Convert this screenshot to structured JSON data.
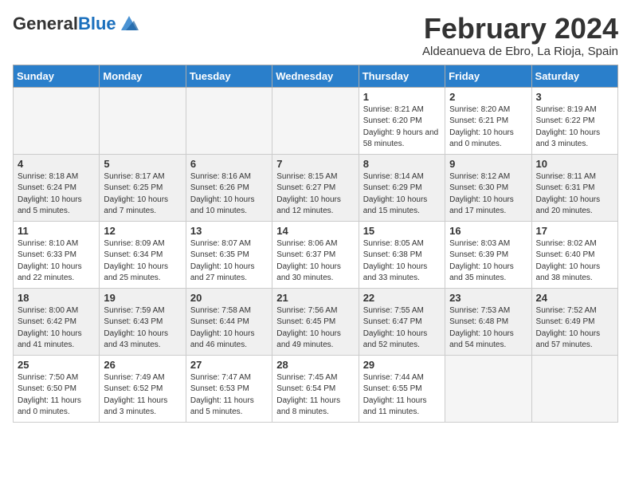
{
  "header": {
    "logo_general": "General",
    "logo_blue": "Blue",
    "month_title": "February 2024",
    "location": "Aldeanueva de Ebro, La Rioja, Spain"
  },
  "days_of_week": [
    "Sunday",
    "Monday",
    "Tuesday",
    "Wednesday",
    "Thursday",
    "Friday",
    "Saturday"
  ],
  "weeks": [
    [
      {
        "day": "",
        "info": ""
      },
      {
        "day": "",
        "info": ""
      },
      {
        "day": "",
        "info": ""
      },
      {
        "day": "",
        "info": ""
      },
      {
        "day": "1",
        "info": "Sunrise: 8:21 AM\nSunset: 6:20 PM\nDaylight: 9 hours and 58 minutes."
      },
      {
        "day": "2",
        "info": "Sunrise: 8:20 AM\nSunset: 6:21 PM\nDaylight: 10 hours and 0 minutes."
      },
      {
        "day": "3",
        "info": "Sunrise: 8:19 AM\nSunset: 6:22 PM\nDaylight: 10 hours and 3 minutes."
      }
    ],
    [
      {
        "day": "4",
        "info": "Sunrise: 8:18 AM\nSunset: 6:24 PM\nDaylight: 10 hours and 5 minutes."
      },
      {
        "day": "5",
        "info": "Sunrise: 8:17 AM\nSunset: 6:25 PM\nDaylight: 10 hours and 7 minutes."
      },
      {
        "day": "6",
        "info": "Sunrise: 8:16 AM\nSunset: 6:26 PM\nDaylight: 10 hours and 10 minutes."
      },
      {
        "day": "7",
        "info": "Sunrise: 8:15 AM\nSunset: 6:27 PM\nDaylight: 10 hours and 12 minutes."
      },
      {
        "day": "8",
        "info": "Sunrise: 8:14 AM\nSunset: 6:29 PM\nDaylight: 10 hours and 15 minutes."
      },
      {
        "day": "9",
        "info": "Sunrise: 8:12 AM\nSunset: 6:30 PM\nDaylight: 10 hours and 17 minutes."
      },
      {
        "day": "10",
        "info": "Sunrise: 8:11 AM\nSunset: 6:31 PM\nDaylight: 10 hours and 20 minutes."
      }
    ],
    [
      {
        "day": "11",
        "info": "Sunrise: 8:10 AM\nSunset: 6:33 PM\nDaylight: 10 hours and 22 minutes."
      },
      {
        "day": "12",
        "info": "Sunrise: 8:09 AM\nSunset: 6:34 PM\nDaylight: 10 hours and 25 minutes."
      },
      {
        "day": "13",
        "info": "Sunrise: 8:07 AM\nSunset: 6:35 PM\nDaylight: 10 hours and 27 minutes."
      },
      {
        "day": "14",
        "info": "Sunrise: 8:06 AM\nSunset: 6:37 PM\nDaylight: 10 hours and 30 minutes."
      },
      {
        "day": "15",
        "info": "Sunrise: 8:05 AM\nSunset: 6:38 PM\nDaylight: 10 hours and 33 minutes."
      },
      {
        "day": "16",
        "info": "Sunrise: 8:03 AM\nSunset: 6:39 PM\nDaylight: 10 hours and 35 minutes."
      },
      {
        "day": "17",
        "info": "Sunrise: 8:02 AM\nSunset: 6:40 PM\nDaylight: 10 hours and 38 minutes."
      }
    ],
    [
      {
        "day": "18",
        "info": "Sunrise: 8:00 AM\nSunset: 6:42 PM\nDaylight: 10 hours and 41 minutes."
      },
      {
        "day": "19",
        "info": "Sunrise: 7:59 AM\nSunset: 6:43 PM\nDaylight: 10 hours and 43 minutes."
      },
      {
        "day": "20",
        "info": "Sunrise: 7:58 AM\nSunset: 6:44 PM\nDaylight: 10 hours and 46 minutes."
      },
      {
        "day": "21",
        "info": "Sunrise: 7:56 AM\nSunset: 6:45 PM\nDaylight: 10 hours and 49 minutes."
      },
      {
        "day": "22",
        "info": "Sunrise: 7:55 AM\nSunset: 6:47 PM\nDaylight: 10 hours and 52 minutes."
      },
      {
        "day": "23",
        "info": "Sunrise: 7:53 AM\nSunset: 6:48 PM\nDaylight: 10 hours and 54 minutes."
      },
      {
        "day": "24",
        "info": "Sunrise: 7:52 AM\nSunset: 6:49 PM\nDaylight: 10 hours and 57 minutes."
      }
    ],
    [
      {
        "day": "25",
        "info": "Sunrise: 7:50 AM\nSunset: 6:50 PM\nDaylight: 11 hours and 0 minutes."
      },
      {
        "day": "26",
        "info": "Sunrise: 7:49 AM\nSunset: 6:52 PM\nDaylight: 11 hours and 3 minutes."
      },
      {
        "day": "27",
        "info": "Sunrise: 7:47 AM\nSunset: 6:53 PM\nDaylight: 11 hours and 5 minutes."
      },
      {
        "day": "28",
        "info": "Sunrise: 7:45 AM\nSunset: 6:54 PM\nDaylight: 11 hours and 8 minutes."
      },
      {
        "day": "29",
        "info": "Sunrise: 7:44 AM\nSunset: 6:55 PM\nDaylight: 11 hours and 11 minutes."
      },
      {
        "day": "",
        "info": ""
      },
      {
        "day": "",
        "info": ""
      }
    ]
  ]
}
